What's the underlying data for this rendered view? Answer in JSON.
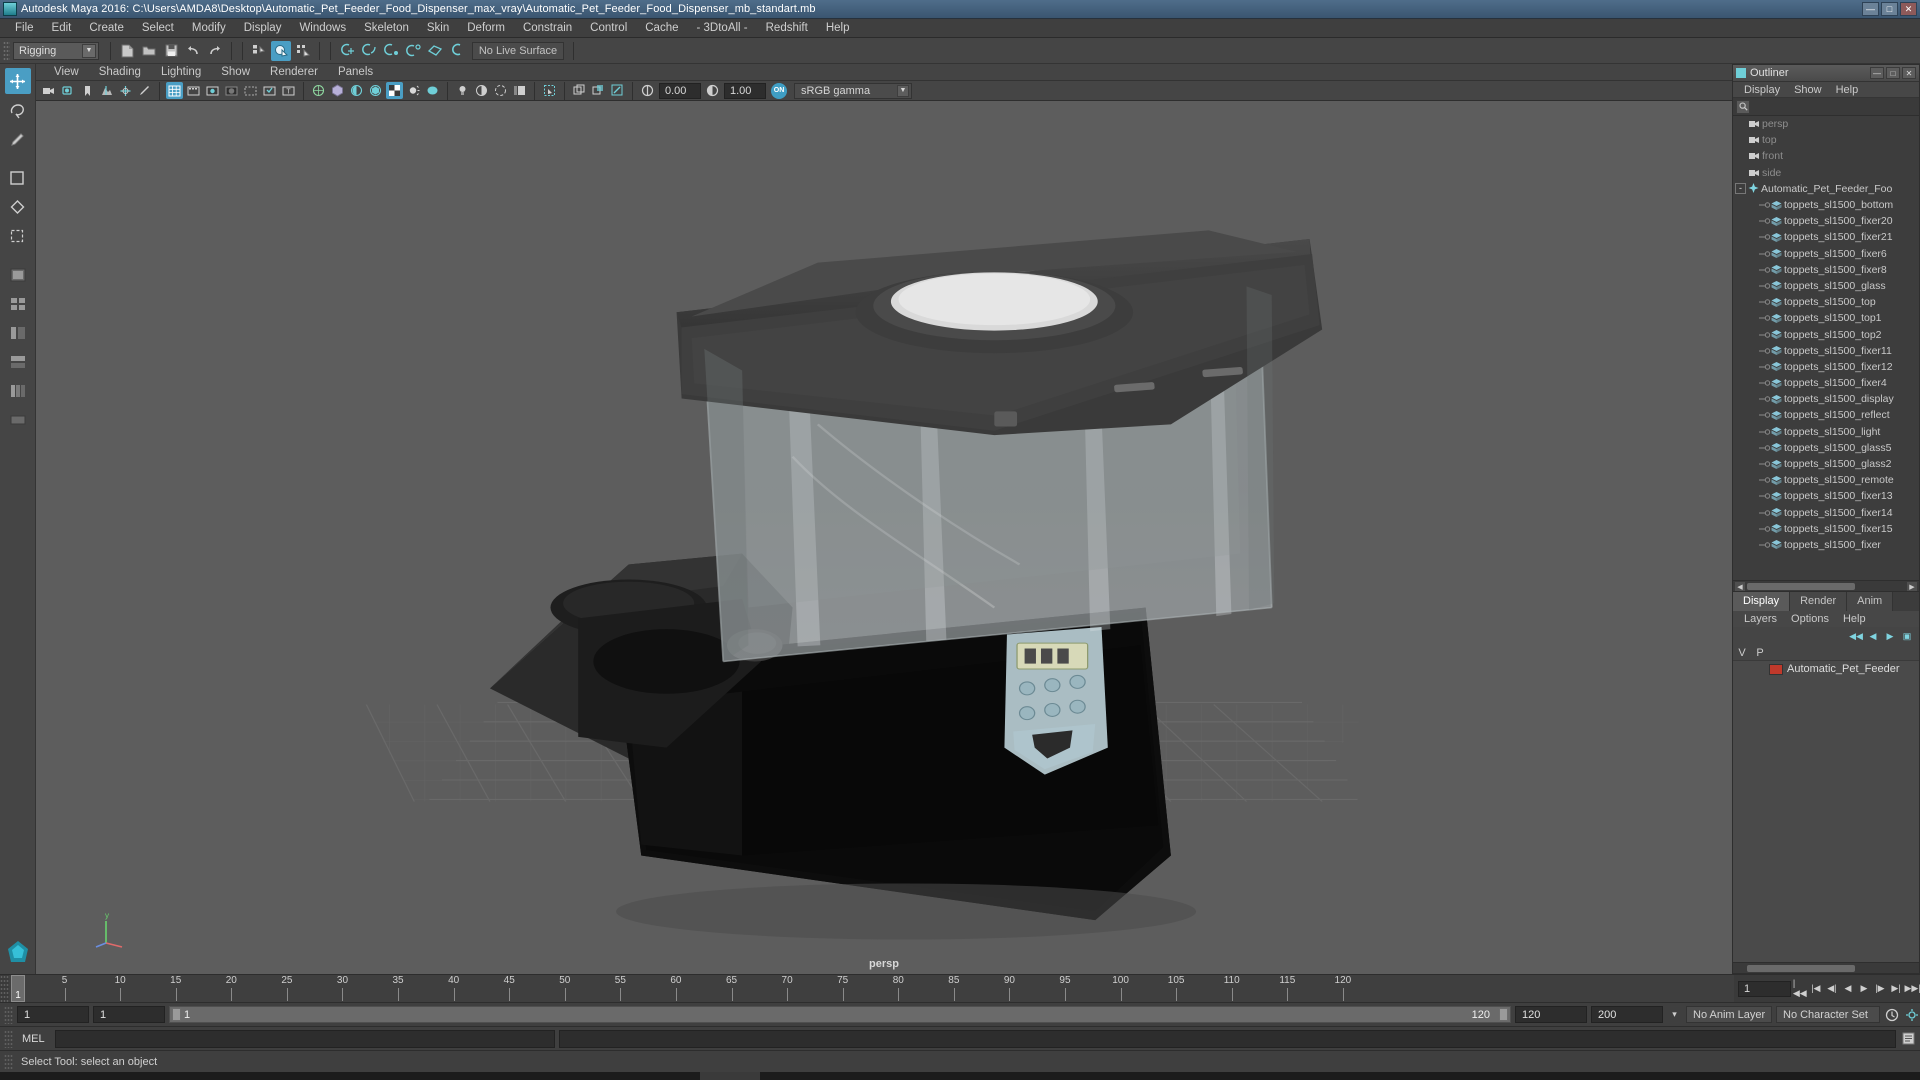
{
  "window": {
    "title": "Autodesk Maya 2016: C:\\Users\\AMDA8\\Desktop\\Automatic_Pet_Feeder_Food_Dispenser_max_vray\\Automatic_Pet_Feeder_Food_Dispenser_mb_standart.mb",
    "minimize": "—",
    "maximize": "□",
    "close": "✕",
    "app_icon": "maya-icon"
  },
  "menubar": {
    "items": [
      "File",
      "Edit",
      "Create",
      "Select",
      "Modify",
      "Display",
      "Windows",
      "Skeleton",
      "Skin",
      "Deform",
      "Constrain",
      "Control",
      "Cache",
      "- 3DtoAll -",
      "Redshift",
      "Help"
    ]
  },
  "statusline": {
    "menu_set": "Rigging",
    "live_surface": "No Live Surface",
    "icons": [
      "new-scene-icon",
      "open-scene-icon",
      "save-scene-icon",
      "undo-icon",
      "redo-icon",
      "select-by-hierarchy-icon",
      "select-by-object-icon",
      "select-by-component-icon",
      "snap-to-grid-icon",
      "snap-to-curve-icon",
      "snap-to-point-icon",
      "snap-to-projected-center-icon",
      "snap-to-view-plane-icon",
      "make-live-icon"
    ]
  },
  "shelf": {
    "icons": [
      "joint-tool-icon",
      "ik-handle-icon",
      "ik-spline-handle-icon",
      "insert-joint-tool-icon",
      "skeleton-icon",
      "bind-skin-icon",
      "smooth-bind-icon",
      "lattice-icon",
      "cluster-icon",
      "parent-constraint-icon",
      "point-constraint-icon",
      "orient-constraint-icon",
      "aim-constraint-icon",
      "scale-constraint-icon",
      "pole-vector-icon",
      "quick-rig-icon",
      "pose-icon",
      "character-icon",
      "mirror-icon"
    ]
  },
  "toolbox": {
    "tools": [
      "select-tool-icon",
      "lasso-select-icon",
      "paint-select-icon",
      "move-tool-icon",
      "rotate-tool-icon",
      "scale-tool-icon",
      "last-tool-icon"
    ],
    "layout_presets": [
      "single-perspective-layout-icon",
      "four-view-layout-icon",
      "persp-outliner-layout-icon",
      "persp-graph-layout-icon",
      "hypershade-layout-icon",
      "persp-render-layout-icon"
    ]
  },
  "viewport": {
    "panel_menu": [
      "View",
      "Shading",
      "Lighting",
      "Show",
      "Renderer",
      "Panels"
    ],
    "camera_label": "persp",
    "exposure": "0.00",
    "gamma": "1.00",
    "color_profile": "sRGB gamma",
    "gamma_toggle": "ON",
    "toolbar_icons": [
      "select-camera-icon",
      "camera-attributes-icon",
      "bookmarks-icon",
      "image-plane-icon",
      "2d-pan-zoom-icon",
      "grease-pencil-icon",
      "grid-icon",
      "film-gate-icon",
      "resolution-gate-icon",
      "gate-mask-icon",
      "field-chart-icon",
      "safe-action-icon",
      "safe-title-icon",
      "wireframe-icon",
      "smooth-shade-all-icon",
      "smooth-shade-selected-icon",
      "flat-shade-icon",
      "use-default-material-icon",
      "shaded-wireframe-icon",
      "textured-icon",
      "use-all-lights-icon",
      "shadows-icon",
      "screen-space-ao-icon",
      "motion-blur-icon",
      "multisample-aa-icon",
      "depth-of-field-icon",
      "isolate-select-icon",
      "xray-icon",
      "xray-joints-icon",
      "xray-active-components-icon",
      "exposure-icon",
      "gamma-icon"
    ]
  },
  "outliner": {
    "title": "Outliner",
    "window_buttons": [
      "—",
      "□",
      "✕"
    ],
    "menu": [
      "Display",
      "Show",
      "Help"
    ],
    "search_icon": "search-icon",
    "items": [
      {
        "label": "persp",
        "indent": 16,
        "icon": "camera-icon",
        "type": "camera",
        "dim": true,
        "expandable": false
      },
      {
        "label": "top",
        "indent": 16,
        "icon": "camera-icon",
        "type": "camera",
        "dim": true,
        "expandable": false
      },
      {
        "label": "front",
        "indent": 16,
        "icon": "camera-icon",
        "type": "camera",
        "dim": true,
        "expandable": false
      },
      {
        "label": "side",
        "indent": 16,
        "icon": "camera-icon",
        "type": "camera",
        "dim": true,
        "expandable": false
      },
      {
        "label": "Automatic_Pet_Feeder_Foo",
        "indent": 2,
        "icon": "group-icon",
        "type": "group",
        "dim": false,
        "expandable": true,
        "expand_state": "-"
      },
      {
        "label": "toppets_sl1500_bottom",
        "indent": 26,
        "icon": "mesh-icon",
        "type": "mesh",
        "dim": false,
        "expandable": false
      },
      {
        "label": "toppets_sl1500_fixer20",
        "indent": 26,
        "icon": "mesh-icon",
        "type": "mesh",
        "dim": false,
        "expandable": false
      },
      {
        "label": "toppets_sl1500_fixer21",
        "indent": 26,
        "icon": "mesh-icon",
        "type": "mesh",
        "dim": false,
        "expandable": false
      },
      {
        "label": "toppets_sl1500_fixer6",
        "indent": 26,
        "icon": "mesh-icon",
        "type": "mesh",
        "dim": false,
        "expandable": false
      },
      {
        "label": "toppets_sl1500_fixer8",
        "indent": 26,
        "icon": "mesh-icon",
        "type": "mesh",
        "dim": false,
        "expandable": false
      },
      {
        "label": "toppets_sl1500_glass",
        "indent": 26,
        "icon": "mesh-icon",
        "type": "mesh",
        "dim": false,
        "expandable": false
      },
      {
        "label": "toppets_sl1500_top",
        "indent": 26,
        "icon": "mesh-icon",
        "type": "mesh",
        "dim": false,
        "expandable": false
      },
      {
        "label": "toppets_sl1500_top1",
        "indent": 26,
        "icon": "mesh-icon",
        "type": "mesh",
        "dim": false,
        "expandable": false
      },
      {
        "label": "toppets_sl1500_top2",
        "indent": 26,
        "icon": "mesh-icon",
        "type": "mesh",
        "dim": false,
        "expandable": false
      },
      {
        "label": "toppets_sl1500_fixer11",
        "indent": 26,
        "icon": "mesh-icon",
        "type": "mesh",
        "dim": false,
        "expandable": false
      },
      {
        "label": "toppets_sl1500_fixer12",
        "indent": 26,
        "icon": "mesh-icon",
        "type": "mesh",
        "dim": false,
        "expandable": false
      },
      {
        "label": "toppets_sl1500_fixer4",
        "indent": 26,
        "icon": "mesh-icon",
        "type": "mesh",
        "dim": false,
        "expandable": false
      },
      {
        "label": "toppets_sl1500_display",
        "indent": 26,
        "icon": "mesh-icon",
        "type": "mesh",
        "dim": false,
        "expandable": false
      },
      {
        "label": "toppets_sl1500_reflect",
        "indent": 26,
        "icon": "mesh-icon",
        "type": "mesh",
        "dim": false,
        "expandable": false
      },
      {
        "label": "toppets_sl1500_light",
        "indent": 26,
        "icon": "mesh-icon",
        "type": "mesh",
        "dim": false,
        "expandable": false
      },
      {
        "label": "toppets_sl1500_glass5",
        "indent": 26,
        "icon": "mesh-icon",
        "type": "mesh",
        "dim": false,
        "expandable": false
      },
      {
        "label": "toppets_sl1500_glass2",
        "indent": 26,
        "icon": "mesh-icon",
        "type": "mesh",
        "dim": false,
        "expandable": false
      },
      {
        "label": "toppets_sl1500_remote",
        "indent": 26,
        "icon": "mesh-icon",
        "type": "mesh",
        "dim": false,
        "expandable": false
      },
      {
        "label": "toppets_sl1500_fixer13",
        "indent": 26,
        "icon": "mesh-icon",
        "type": "mesh",
        "dim": false,
        "expandable": false
      },
      {
        "label": "toppets_sl1500_fixer14",
        "indent": 26,
        "icon": "mesh-icon",
        "type": "mesh",
        "dim": false,
        "expandable": false
      },
      {
        "label": "toppets_sl1500_fixer15",
        "indent": 26,
        "icon": "mesh-icon",
        "type": "mesh",
        "dim": false,
        "expandable": false
      },
      {
        "label": "toppets_sl1500_fixer",
        "indent": 26,
        "icon": "mesh-icon",
        "type": "mesh",
        "dim": false,
        "expandable": false
      }
    ]
  },
  "layer_editor": {
    "tabs": [
      "Display",
      "Render",
      "Anim"
    ],
    "active_tab": "Display",
    "menu": [
      "Layers",
      "Options",
      "Help"
    ],
    "buttons": [
      "layer-first-icon",
      "layer-prev-icon",
      "layer-next-icon",
      "layer-new-icon"
    ],
    "columns": [
      "V",
      "P",
      ""
    ],
    "rows": [
      {
        "v": "",
        "p": "",
        "color": "#c0392b",
        "name": "Automatic_Pet_Feeder"
      }
    ]
  },
  "timeline": {
    "current_frame": "1",
    "tick_labels": [
      5,
      10,
      15,
      20,
      25,
      30,
      35,
      40,
      45,
      50,
      55,
      60,
      65,
      70,
      75,
      80,
      85,
      90,
      95,
      100,
      105,
      110,
      115,
      120
    ],
    "frame_field": "1",
    "playback_controls": [
      "go-to-start-icon",
      "step-back-frame-icon",
      "step-back-key-icon",
      "play-backwards-icon",
      "play-forwards-icon",
      "step-forward-key-icon",
      "step-forward-frame-icon",
      "go-to-end-icon"
    ]
  },
  "range_slider": {
    "start_field": "1",
    "anim_start_field": "1",
    "slider_start_label": "1",
    "slider_end_label": "120",
    "anim_end_field": "120",
    "end_field": "200",
    "anim_layer": "No Anim Layer",
    "character_set": "No Character Set",
    "key_icon": "auto-keyframe-icon",
    "prefs_icon": "animation-preferences-icon"
  },
  "command_line": {
    "language_label": "MEL",
    "input_value": "",
    "output_value": "",
    "icons": [
      "script-editor-icon"
    ]
  },
  "help_line": {
    "text": "Select Tool: select an object"
  },
  "colors": {
    "accent_blue": "#4a9ec4",
    "teal_icon": "#6fcfd8",
    "purple_icon": "#b0a6d8",
    "layer_swatch": "#c0392b",
    "panel_bg": "#454545",
    "viewport_bg": "#5d5d5d"
  }
}
